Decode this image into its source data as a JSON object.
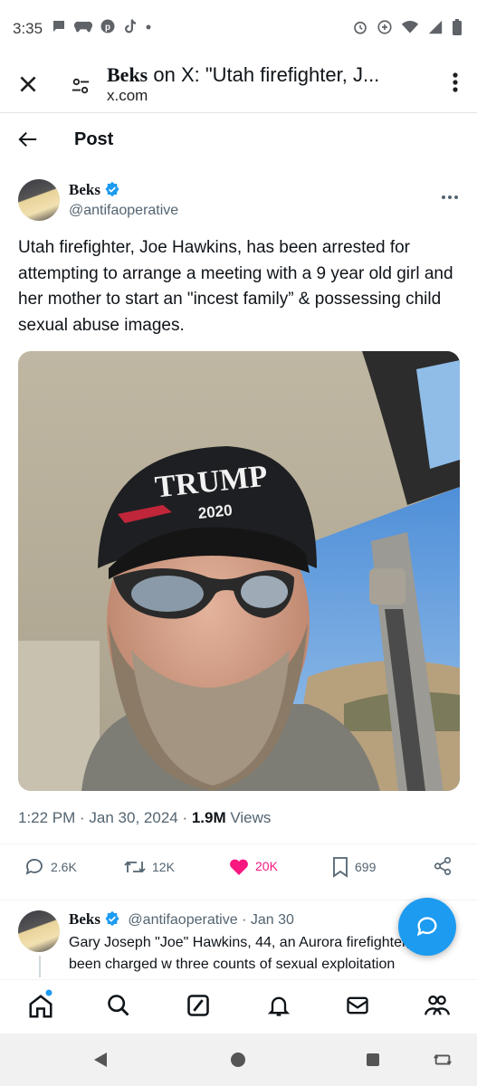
{
  "status_bar": {
    "time": "3:35",
    "left_icons": [
      "chat-bubble-icon",
      "gamepad-icon",
      "pinterest-icon",
      "tiktok-icon",
      "dot-icon"
    ],
    "right_icons": [
      "alarm-icon",
      "data-saver-icon",
      "wifi-icon",
      "signal-icon",
      "battery-icon"
    ]
  },
  "browser_bar": {
    "title_name": "Beks",
    "title_rest": " on X: \"Utah firefighter, J...",
    "domain": "x.com"
  },
  "post_header": {
    "title": "Post"
  },
  "tweet": {
    "author_name": "Beks",
    "author_handle": "@antifaoperative",
    "text": "Utah firefighter, Joe Hawkins, has been arrested for attempting to arrange a meeting with a 9 year old girl and her mother to start an \"incest family” & possessing child sexual abuse images.",
    "photo": {
      "cap_text_1": "TRUMP",
      "cap_text_2": "2020"
    },
    "time": "1:22 PM",
    "date": "Jan 30, 2024",
    "views_count": "1.9M",
    "views_label": "Views",
    "replies": "2.6K",
    "reposts": "12K",
    "likes": "20K",
    "bookmarks": "699"
  },
  "reply_tweet": {
    "author_name": "Beks",
    "author_handle": "@antifaoperative",
    "date": "· Jan 30",
    "text": "Gary Joseph \"Joe\" Hawkins, 44, an Aurora firefighter, has been charged w three counts of sexual exploitation"
  },
  "colors": {
    "accent": "#1d9bf0",
    "like": "#f91880",
    "muted": "#536471",
    "text": "#0f1419"
  },
  "bottom_nav": [
    "home-icon",
    "search-icon",
    "grok-icon",
    "notifications-icon",
    "messages-icon",
    "communities-icon"
  ]
}
